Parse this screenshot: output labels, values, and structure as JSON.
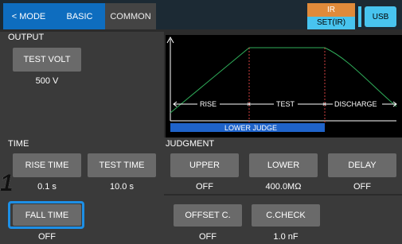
{
  "tabs": {
    "mode": "< MODE",
    "basic": "BASIC",
    "common": "COMMON"
  },
  "status": {
    "ir_top": "IR",
    "ir_bottom": "SET(IR)",
    "usb": "USB"
  },
  "output": {
    "title": "OUTPUT",
    "test_volt_label": "TEST VOLT",
    "test_volt_value": "500 V"
  },
  "graph": {
    "rise": "RISE",
    "test": "TEST",
    "discharge": "DISCHARGE",
    "lower_judge": "LOWER JUDGE"
  },
  "time": {
    "title": "TIME",
    "rise_time_label": "RISE TIME",
    "rise_time_value": "0.1 s",
    "test_time_label": "TEST TIME",
    "test_time_value": "10.0 s",
    "fall_time_label": "FALL TIME",
    "fall_time_value": "OFF"
  },
  "judgment": {
    "title": "JUDGMENT",
    "upper_label": "UPPER",
    "upper_value": "OFF",
    "lower_label": "LOWER",
    "lower_value": "400.0MΩ",
    "delay_label": "DELAY",
    "delay_value": "OFF",
    "offset_label": "OFFSET C.",
    "offset_value": "OFF",
    "ccheck_label": "C.CHECK",
    "ccheck_value": "1.0 nF"
  },
  "step_marker": "1",
  "colors": {
    "tab_active": "#0e6dbf",
    "ir_orange": "#e08a3a",
    "ir_cyan": "#48c4ef",
    "curve_green": "#2fae5a",
    "judge_bar": "#1f63c9",
    "highlight": "#1d8fe6"
  }
}
